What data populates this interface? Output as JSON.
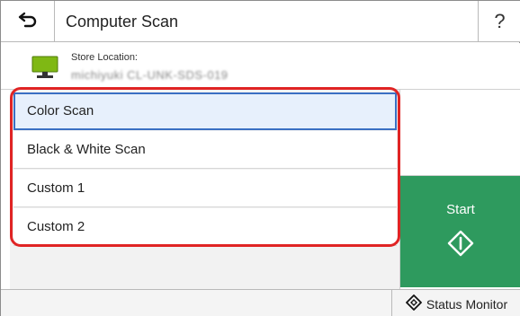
{
  "header": {
    "title": "Computer Scan",
    "help_label": "?"
  },
  "store": {
    "label": "Store Location:",
    "value": "michiyuki CL-UNK-SDS-019"
  },
  "scan_options": [
    {
      "label": "Color Scan",
      "selected": true
    },
    {
      "label": "Black & White Scan",
      "selected": false
    },
    {
      "label": "Custom 1",
      "selected": false
    },
    {
      "label": "Custom 2",
      "selected": false
    }
  ],
  "start_button": {
    "label": "Start",
    "color": "#2e9a5e"
  },
  "footer": {
    "status_monitor_label": "Status Monitor"
  },
  "colors": {
    "highlight": "#e02424",
    "selection_border": "#3a6fc3",
    "monitor_icon": "#7fb814"
  },
  "icons": {
    "back": "back-arrow-icon",
    "monitor": "computer-monitor-icon",
    "start": "start-diamond-icon",
    "status": "status-monitor-icon"
  }
}
